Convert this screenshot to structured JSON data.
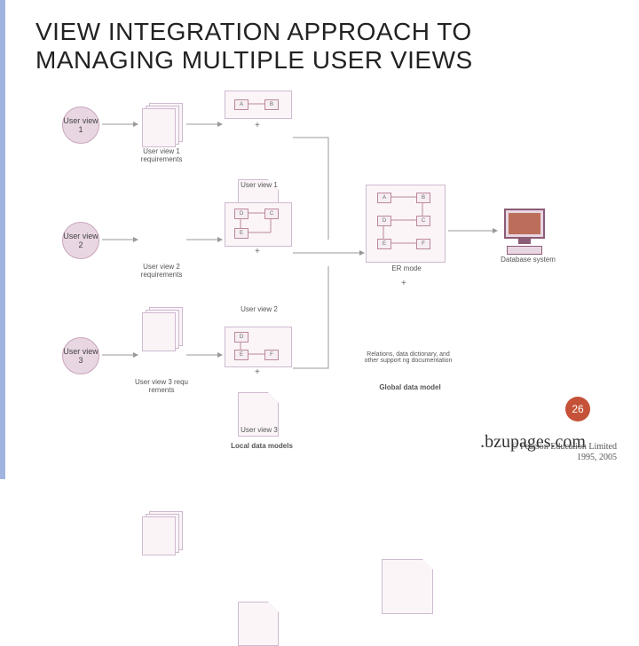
{
  "title": "VIEW INTEGRATION APPROACH TO MANAGING MULTIPLE USER VIEWS",
  "page_number": "26",
  "watermark": ".bzupages.com",
  "copyright_line1": "© Pearson Education Limited",
  "copyright_line2": "1995, 2005",
  "user_views": [
    {
      "circle": "User view 1",
      "req": "User view 1 requirements",
      "doc": "User view 1"
    },
    {
      "circle": "User view 2",
      "req": "User view 2 requirements",
      "doc": "User view 2"
    },
    {
      "circle": "User view 3",
      "req": "User view 3 requ rements",
      "doc": "User view 3"
    }
  ],
  "erboxes_row1": {
    "v1": [
      "A",
      "B"
    ],
    "v2": [
      "D",
      "C",
      "E"
    ],
    "v3": [
      "D",
      "E",
      "F"
    ]
  },
  "global": {
    "er_label": "ER mode",
    "doc_label": "Relations, data dictionary, and other support ng documentation",
    "caption": "Global data model",
    "boxes": [
      "A",
      "B",
      "D",
      "C",
      "E",
      "F"
    ]
  },
  "local_caption": "Local data models",
  "db_label": "Database system"
}
